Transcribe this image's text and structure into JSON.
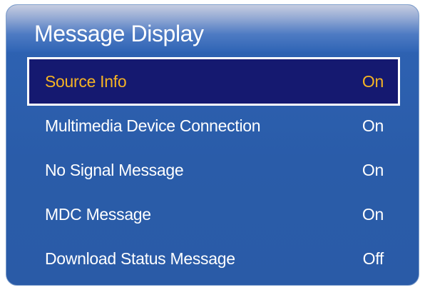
{
  "dialog": {
    "title": "Message Display",
    "items": [
      {
        "label": "Source Info",
        "value": "On"
      },
      {
        "label": "Multimedia Device Connection",
        "value": "On"
      },
      {
        "label": "No Signal Message",
        "value": "On"
      },
      {
        "label": "MDC Message",
        "value": "On"
      },
      {
        "label": "Download Status Message",
        "value": "Off"
      }
    ],
    "selected_index": 0
  },
  "colors": {
    "panel_blue": "#2a5ca9",
    "highlight_bg": "#151970",
    "highlight_text": "#f5b324",
    "text": "#ffffff"
  }
}
